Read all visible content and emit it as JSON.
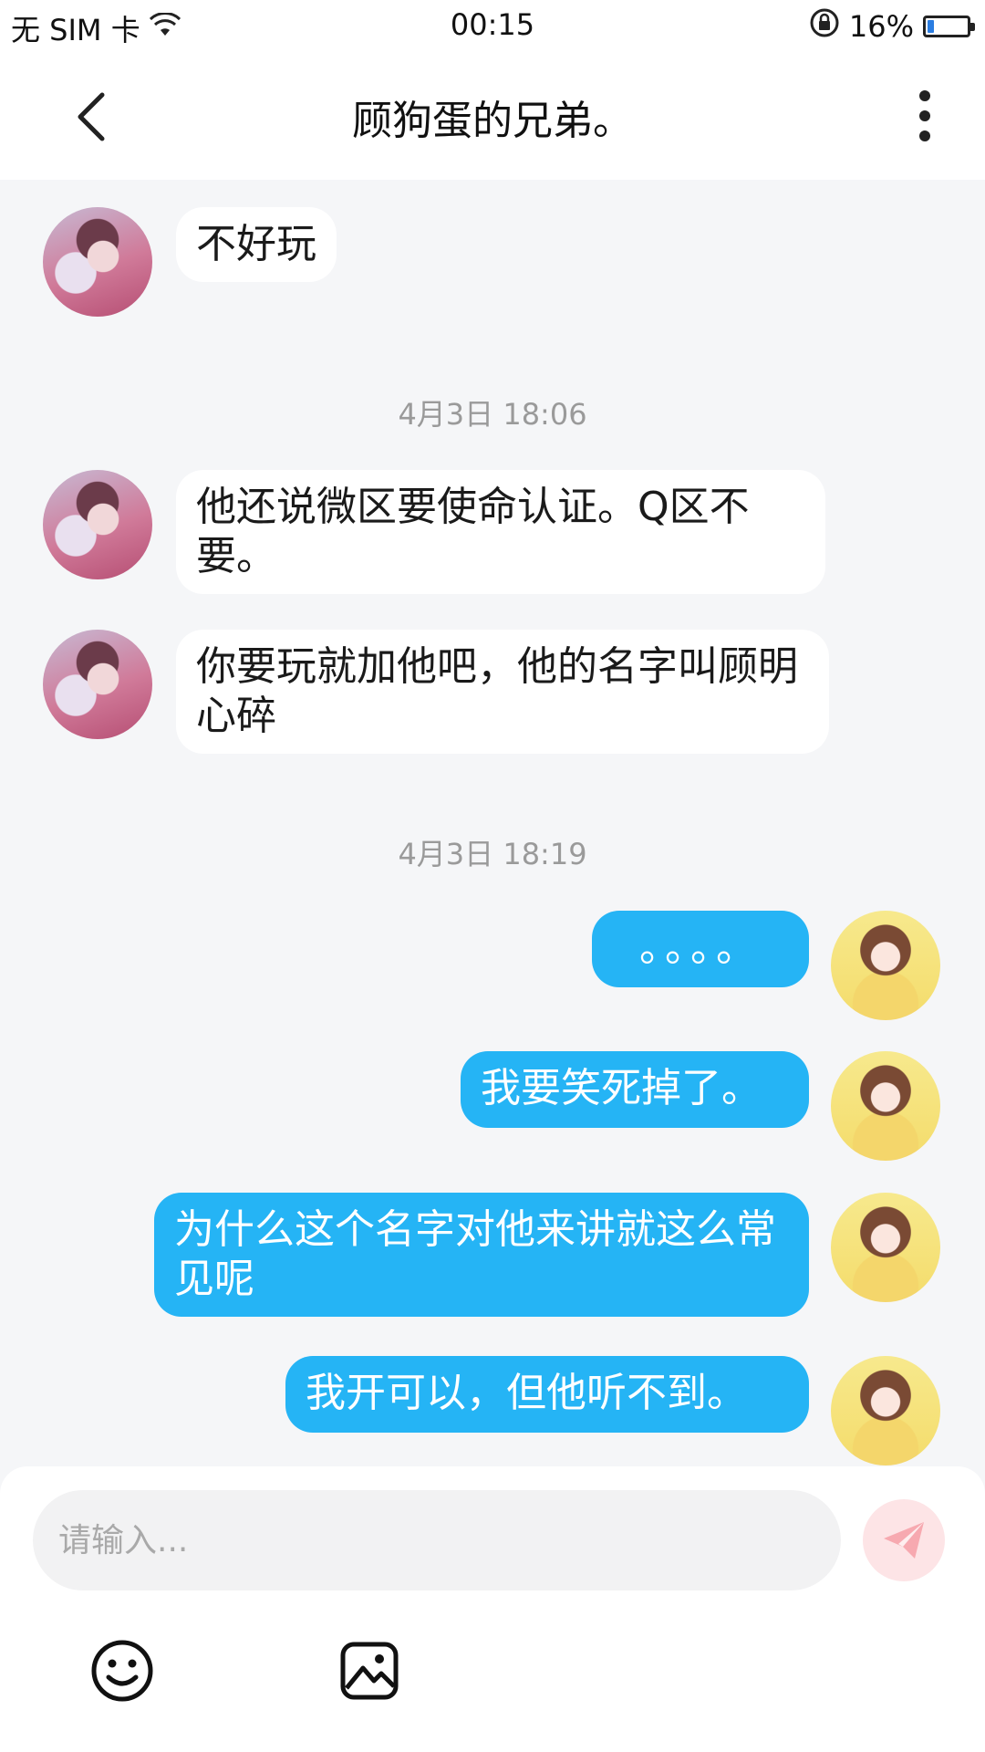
{
  "status_bar": {
    "carrier": "无 SIM 卡",
    "time": "00:15",
    "battery_percent": "16%",
    "battery_level": 0.16,
    "icons": [
      "wifi-icon",
      "rotation-lock-icon",
      "battery-icon"
    ]
  },
  "header": {
    "title": "顾狗蛋的兄弟。",
    "back_icon": "back-arrow-icon",
    "more_icon": "more-vertical-icon"
  },
  "messages": [
    {
      "side": "left",
      "text": "不好玩"
    },
    {
      "type": "timestamp",
      "text": "4月3日 18:06"
    },
    {
      "side": "left",
      "text": " 他还说微区要使命认证。Q区不要。"
    },
    {
      "side": "left",
      "text": "你要玩就加他吧，他的名字叫顾明心碎"
    },
    {
      "type": "timestamp",
      "text": "4月3日 18:19"
    },
    {
      "side": "right",
      "text": "。。。。"
    },
    {
      "side": "right",
      "text": "我要笑死掉了。"
    },
    {
      "side": "right",
      "text": "为什么这个名字对他来讲就这么常见呢"
    },
    {
      "side": "right",
      "text": "我开可以，但他听不到。"
    }
  ],
  "input": {
    "placeholder": "请输入..."
  },
  "toolbar": {
    "icons": [
      "emoji-icon",
      "image-icon",
      "send-icon"
    ]
  },
  "colors": {
    "accent": "#25b4f5",
    "send_button_bg": "#fde4e6",
    "send_icon": "#f7a9b0",
    "background": "#f5f6f8"
  }
}
